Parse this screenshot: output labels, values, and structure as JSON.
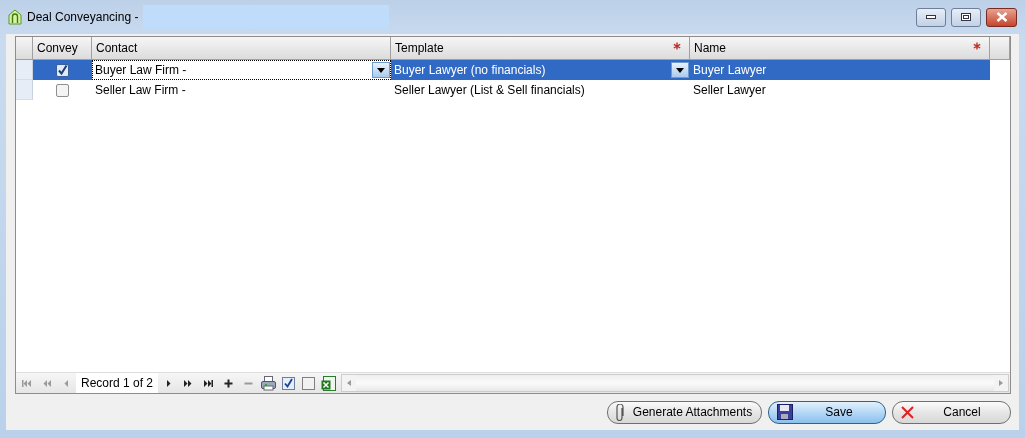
{
  "window": {
    "title": "Deal Conveyancing -"
  },
  "grid": {
    "columns": [
      {
        "label": "Convey",
        "kind": "check",
        "required": false
      },
      {
        "label": "Contact",
        "kind": "combo",
        "required": false
      },
      {
        "label": "Template",
        "kind": "combo",
        "required": true
      },
      {
        "label": "Name",
        "kind": "text",
        "required": true
      }
    ],
    "rows": [
      {
        "selected": true,
        "cells": [
          {
            "checked": true
          },
          {
            "text": "Buyer Law Firm -",
            "editing": true
          },
          {
            "text": "Buyer Lawyer (no financials)",
            "editing": false
          },
          {
            "text": "Buyer Lawyer",
            "editing": false
          }
        ]
      },
      {
        "selected": false,
        "cells": [
          {
            "checked": false
          },
          {
            "text": "Seller Law Firm -",
            "editing": false
          },
          {
            "text": "Seller Lawyer (List & Sell financials)",
            "editing": false
          },
          {
            "text": "Seller Lawyer",
            "editing": false
          }
        ]
      }
    ]
  },
  "navigator": {
    "before": [
      {
        "kind": "first",
        "disabled": true
      },
      {
        "kind": "prev-page",
        "disabled": true
      },
      {
        "kind": "prev",
        "disabled": true
      }
    ],
    "record": "Record 1 of 2",
    "after": [
      {
        "kind": "next",
        "disabled": false
      },
      {
        "kind": "next-page",
        "disabled": false
      },
      {
        "kind": "last",
        "disabled": false
      },
      {
        "kind": "add",
        "disabled": false
      },
      {
        "kind": "remove",
        "disabled": true
      },
      {
        "kind": "print",
        "disabled": false
      },
      {
        "kind": "check-all",
        "disabled": false
      },
      {
        "kind": "uncheck-all",
        "disabled": false
      },
      {
        "kind": "excel",
        "disabled": false
      }
    ]
  },
  "buttons": [
    {
      "label": "Generate Attachments",
      "kind": "attach",
      "default": false
    },
    {
      "label": "Save",
      "kind": "save",
      "default": true
    },
    {
      "label": "Cancel",
      "kind": "cancel",
      "default": false
    }
  ]
}
